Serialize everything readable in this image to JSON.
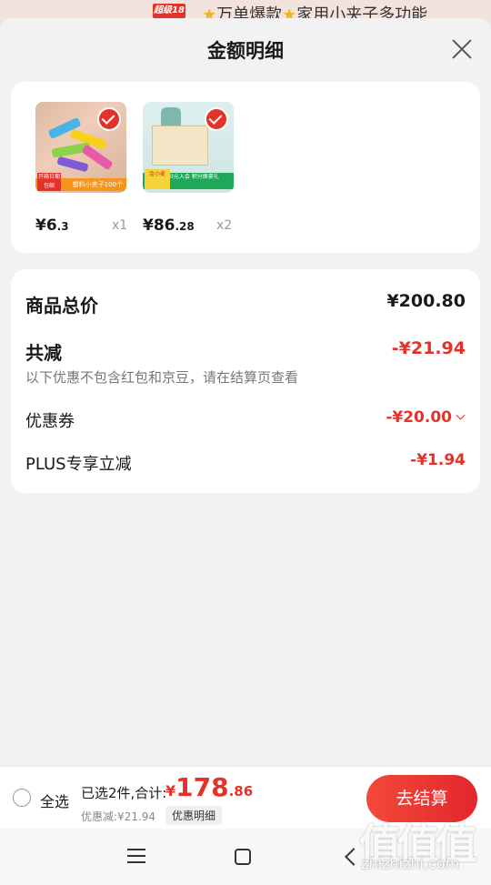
{
  "background": {
    "badge": "超级18",
    "text": "万单爆款",
    "text2": "家用小夹子多功能"
  },
  "sheet": {
    "title": "金额明细"
  },
  "products": [
    {
      "price_int": "¥6",
      "price_dec": ".3",
      "qty": "x1",
      "tag_box": "开箱日期 包邮",
      "tag_bar": "塑料小夹子100个"
    },
    {
      "price_int": "¥86",
      "price_dec": ".28",
      "qty": "x2",
      "tag_box": "金小麦",
      "tag_bar": "0元入会 积分换豪礼"
    }
  ],
  "summary": {
    "total_label": "商品总价",
    "total_value": "¥200.80",
    "reduce_label": "共减",
    "reduce_value": "-¥21.94",
    "note": "以下优惠不包含红包和京豆，请在结算页查看",
    "coupon_label": "优惠券",
    "coupon_value": "-¥20.00",
    "plus_label": "PLUS专享立减",
    "plus_value": "-¥1.94"
  },
  "bottom": {
    "select_all": "全选",
    "selected_text": "已选2件,合计:",
    "total_yen": "¥",
    "total_int": "178",
    "total_dec": ".86",
    "discount_text": "优惠减:¥21.94",
    "detail_button": "优惠明细",
    "checkout_button": "去结算"
  },
  "watermark": {
    "mark": "值值值",
    "site": "zhizhizhi.com"
  },
  "colors": {
    "accent": "#e3322a",
    "card": "#ffffff",
    "sheet_bg": "#f2f2f2"
  },
  "icons": {
    "close": "close-icon",
    "check": "check-icon",
    "menu": "menu-icon",
    "home": "home-icon",
    "back": "back-icon"
  }
}
